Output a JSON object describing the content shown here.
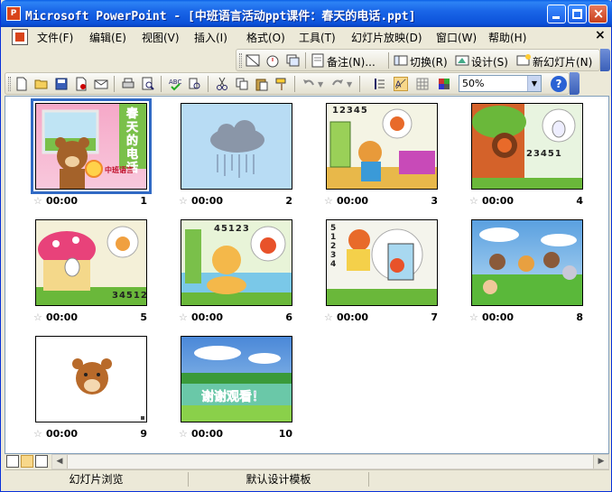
{
  "window": {
    "title": "Microsoft PowerPoint - [中班语言活动ppt课件：春天的电话.ppt]",
    "app_icon_label": "P"
  },
  "menu": {
    "items": [
      {
        "label": "文件(F)"
      },
      {
        "label": "编辑(E)"
      },
      {
        "label": "视图(V)"
      },
      {
        "label": "插入(I)"
      },
      {
        "label": "格式(O)"
      },
      {
        "label": "工具(T)"
      },
      {
        "label": "幻灯片放映(D)"
      },
      {
        "label": "窗口(W)"
      },
      {
        "label": "帮助(H)"
      }
    ],
    "close_glyph": "×"
  },
  "view_toolbar": {
    "notes_label": "备注(N)...",
    "transition_label": "切换(R)",
    "design_label": "设计(S)",
    "new_slide_label": "新幻灯片(N)"
  },
  "standard_toolbar": {
    "zoom_value": "50%",
    "help_glyph": "?"
  },
  "slides": [
    {
      "number": "1",
      "time": "00:00",
      "title_text": "春天的电话",
      "badge": "中班语言"
    },
    {
      "number": "2",
      "time": "00:00"
    },
    {
      "number": "3",
      "time": "00:00",
      "digits": "12345"
    },
    {
      "number": "4",
      "time": "00:00",
      "digits": "23451"
    },
    {
      "number": "5",
      "time": "00:00",
      "digits": "34512"
    },
    {
      "number": "6",
      "time": "00:00",
      "digits": "45123"
    },
    {
      "number": "7",
      "time": "00:00",
      "digits": "51234"
    },
    {
      "number": "8",
      "time": "00:00"
    },
    {
      "number": "9",
      "time": "00:00"
    },
    {
      "number": "10",
      "time": "00:00",
      "title_text": "谢谢观看！"
    }
  ],
  "status": {
    "view_name": "幻灯片浏览",
    "template_name": "默认设计模板"
  },
  "colors": {
    "title_bar": "#0b51d9",
    "selection": "#316ac5",
    "chrome": "#ece9d8"
  }
}
